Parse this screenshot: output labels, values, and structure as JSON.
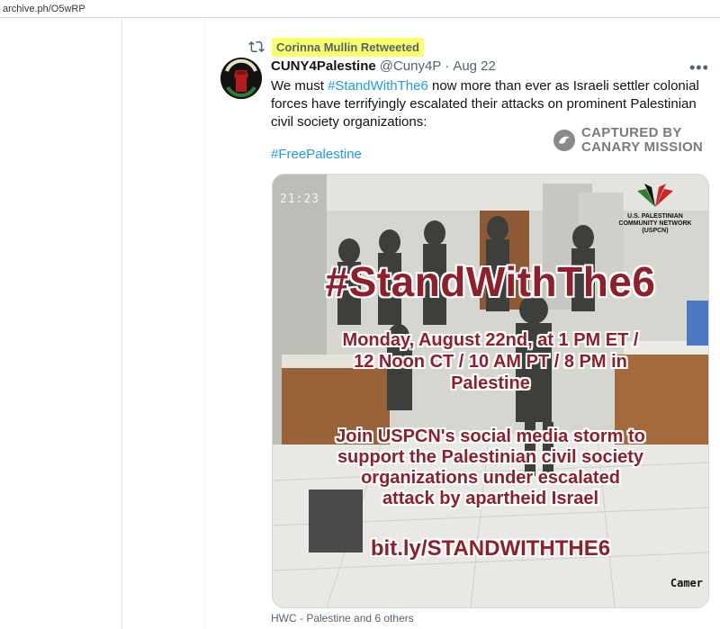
{
  "browser": {
    "url": "archive.ph/O5wRP"
  },
  "retweet": {
    "label": "Corinna Mullin Retweeted"
  },
  "tweet": {
    "display_name": "CUNY4Palestine",
    "handle": "@Cuny4P",
    "date": "Aug 22",
    "more": "•••",
    "text_prefix": "We must ",
    "text_link": "#StandWithThe6",
    "text_suffix": " now more than ever as Israeli settler colonial forces have terrifyingly escalated their attacks on prominent Palestinian civil society organizations:",
    "hashtag": "#FreePalestine",
    "media_caption": "HWC - Palestine and 6 others"
  },
  "watermark": {
    "line1": "CAPTURED BY",
    "line2": "CANARY MISSION"
  },
  "media": {
    "timestamp": "21:23",
    "camera_label": "Camer",
    "logo_lines": [
      "U.S. PALESTINIAN",
      "COMMUNITY NETWORK",
      "(USPCN)"
    ],
    "headline": "#StandWithThe6",
    "sub_lines": [
      "Monday, August 22nd, at 1 PM ET /",
      "12 Noon CT / 10 AM PT / 8 PM in",
      "Palestine"
    ],
    "body_lines": [
      "Join USPCN's social media storm to",
      "support the Palestinian civil society",
      "organizations under escalated",
      "attack by apartheid Israel"
    ],
    "link": "bit.ly/STANDWITHTHE6"
  },
  "colors": {
    "link": "#1d9bf0",
    "highlight": "#f8ff6b",
    "poster_text": "#8e1f2b"
  }
}
